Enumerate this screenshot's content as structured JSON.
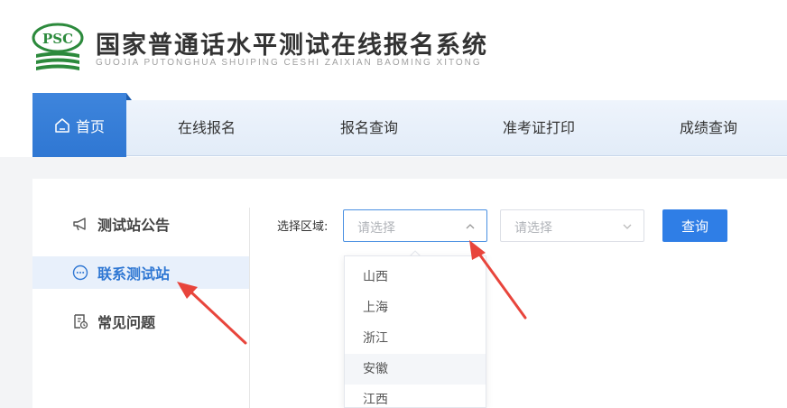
{
  "header": {
    "title": "国家普通话水平测试在线报名系统",
    "subtitle": "GUOJIA PUTONGHUA SHUIPING CESHI ZAIXIAN BAOMING XITONG",
    "logo_text": "PSC"
  },
  "nav": {
    "home": "首页",
    "items": [
      "在线报名",
      "报名查询",
      "准考证打印",
      "成绩查询"
    ]
  },
  "sidebar": {
    "items": [
      {
        "label": "测试站公告",
        "icon": "megaphone-icon",
        "active": false
      },
      {
        "label": "联系测试站",
        "icon": "chat-icon",
        "active": true
      },
      {
        "label": "常见问题",
        "icon": "document-icon",
        "active": false
      }
    ]
  },
  "filter": {
    "label": "选择区域:",
    "region_placeholder": "请选择",
    "sub_placeholder": "请选择",
    "query_button": "查询"
  },
  "dropdown": {
    "options": [
      "山西",
      "上海",
      "浙江",
      "安徽",
      "江西"
    ],
    "hovered": "安徽"
  },
  "colors": {
    "accent": "#2f77d3",
    "annotation_arrow": "#e8453c"
  }
}
